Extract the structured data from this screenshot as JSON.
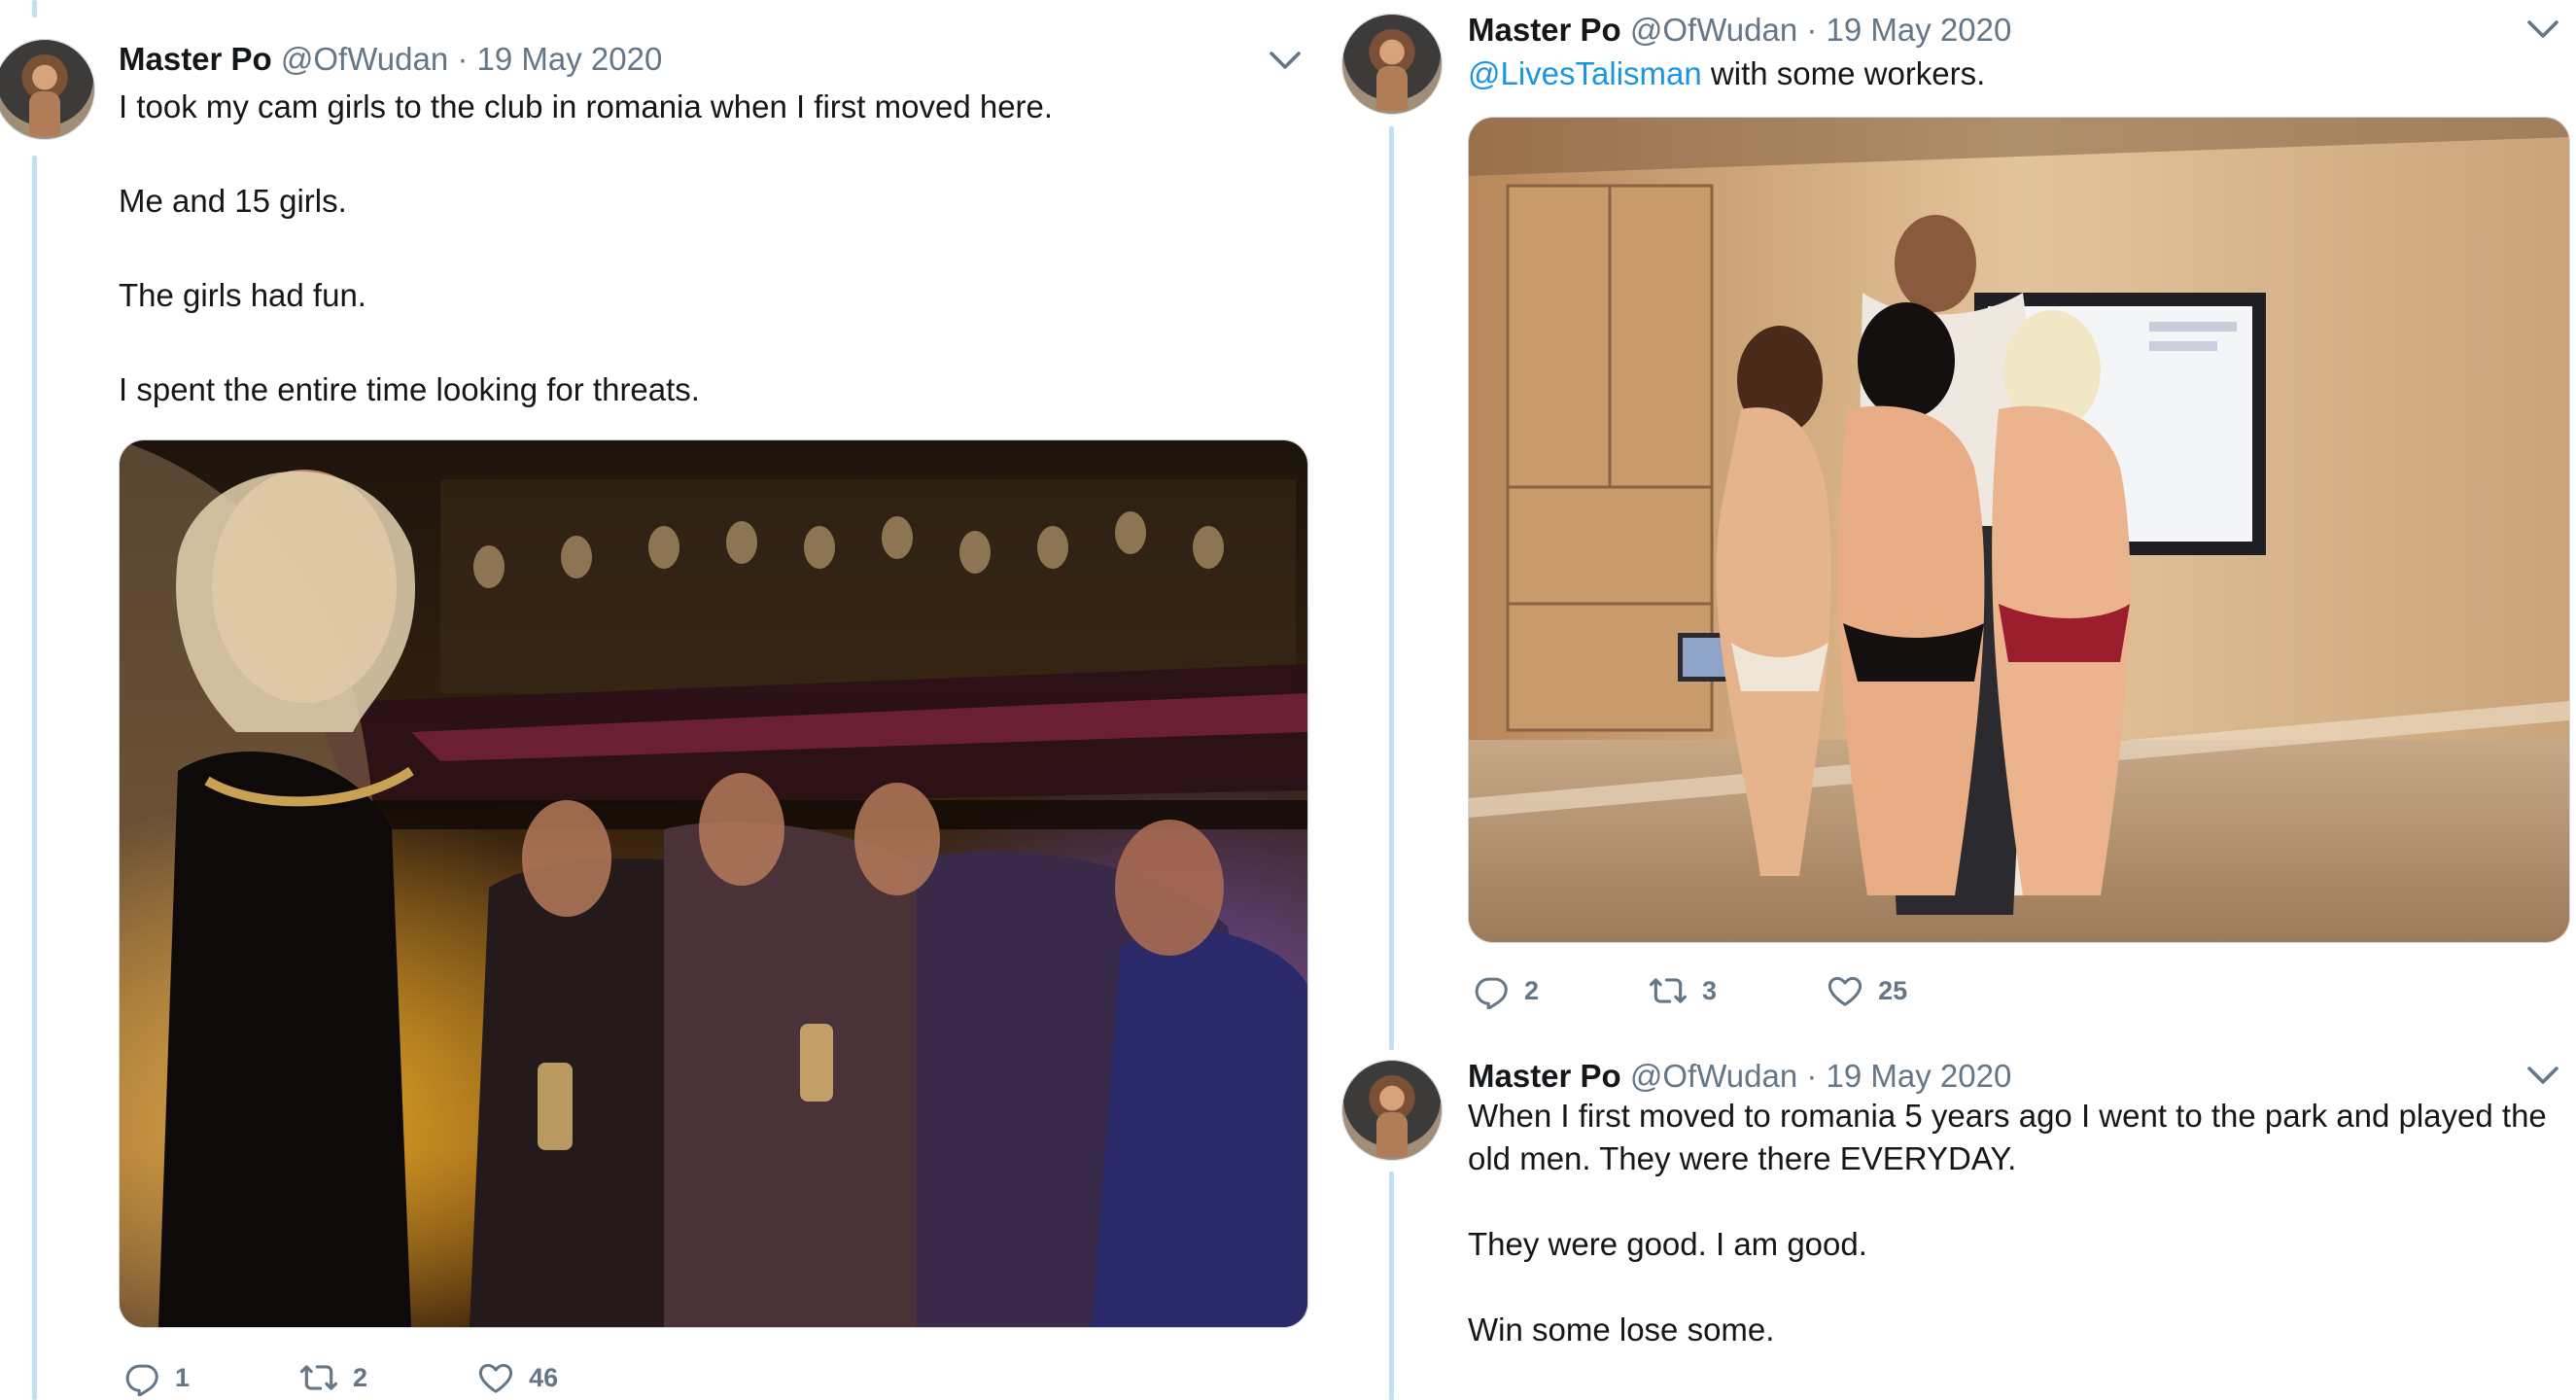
{
  "tweets": [
    {
      "name": "Master Po",
      "handle": "@OfWudan",
      "separator": "·",
      "date": "19 May 2020",
      "paragraphs": [
        "I took my cam girls to the club in romania when I first moved here.",
        "Me and 15 girls.",
        "The girls had fun.",
        "I spent the entire time looking for threats."
      ],
      "replies": "1",
      "retweets": "2",
      "likes": "46",
      "icons": {
        "reply": "reply-icon",
        "retweet": "retweet-icon",
        "like": "heart-icon",
        "menu": "chevron-down-icon"
      }
    },
    {
      "name": "Master Po",
      "handle": "@OfWudan",
      "separator": "·",
      "date": "19 May 2020",
      "mention": "@LivesTalisman",
      "text_after_mention": " with some workers.",
      "replies": "2",
      "retweets": "3",
      "likes": "25",
      "icons": {
        "reply": "reply-icon",
        "retweet": "retweet-icon",
        "like": "heart-icon",
        "menu": "chevron-down-icon"
      }
    },
    {
      "name": "Master Po",
      "handle": "@OfWudan",
      "separator": "·",
      "date": "19 May 2020",
      "paragraphs": [
        "When I first moved to romania 5 years ago I went to the park and played the old men. They were there EVERYDAY.",
        "They were good. I am good.",
        "Win some lose some."
      ],
      "icons": {
        "menu": "chevron-down-icon"
      }
    }
  ],
  "colors": {
    "text": "#14171a",
    "secondary": "#657786",
    "link": "#1b95e0",
    "thread_line": "#bfe0f5"
  }
}
